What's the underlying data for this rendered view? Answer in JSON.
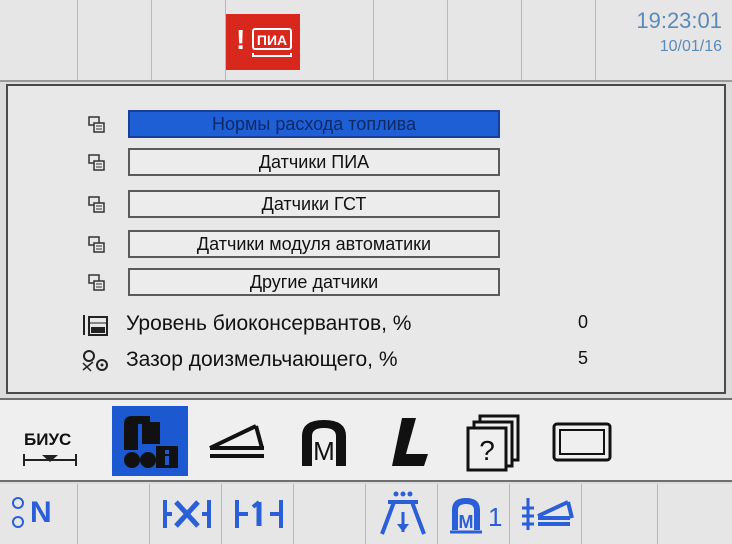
{
  "header": {
    "alarm_label": "ПИА",
    "alarm_mark": "!",
    "time": "19:23:01",
    "date": "10/01/16"
  },
  "menu": {
    "items": [
      {
        "label": "Нормы расхода топлива",
        "selected": true
      },
      {
        "label": "Датчики ПИА",
        "selected": false
      },
      {
        "label": "Датчики ГСТ",
        "selected": false
      },
      {
        "label": "Датчики модуля автоматики",
        "selected": false
      },
      {
        "label": "Другие датчики",
        "selected": false
      }
    ]
  },
  "params": [
    {
      "label": "Уровень биоконсервантов, %",
      "value": "0",
      "icon": "tank-level-icon"
    },
    {
      "label": "Зазор доизмельчающего, %",
      "value": "5",
      "icon": "gap-setting-icon"
    }
  ],
  "toolbar": {
    "biys_label": "БИУС",
    "tools": [
      "sensor-info-icon",
      "chute-icon",
      "engine-icon",
      "l-tool-icon",
      "help-icon",
      "screen-icon"
    ]
  },
  "bottom": {
    "neutral_label": "N",
    "knife_label": "1",
    "engine_label": "1"
  },
  "colors": {
    "accent_blue": "#1f5fd6",
    "alarm_red": "#d8281e",
    "clock_blue": "#5a8ab8"
  }
}
